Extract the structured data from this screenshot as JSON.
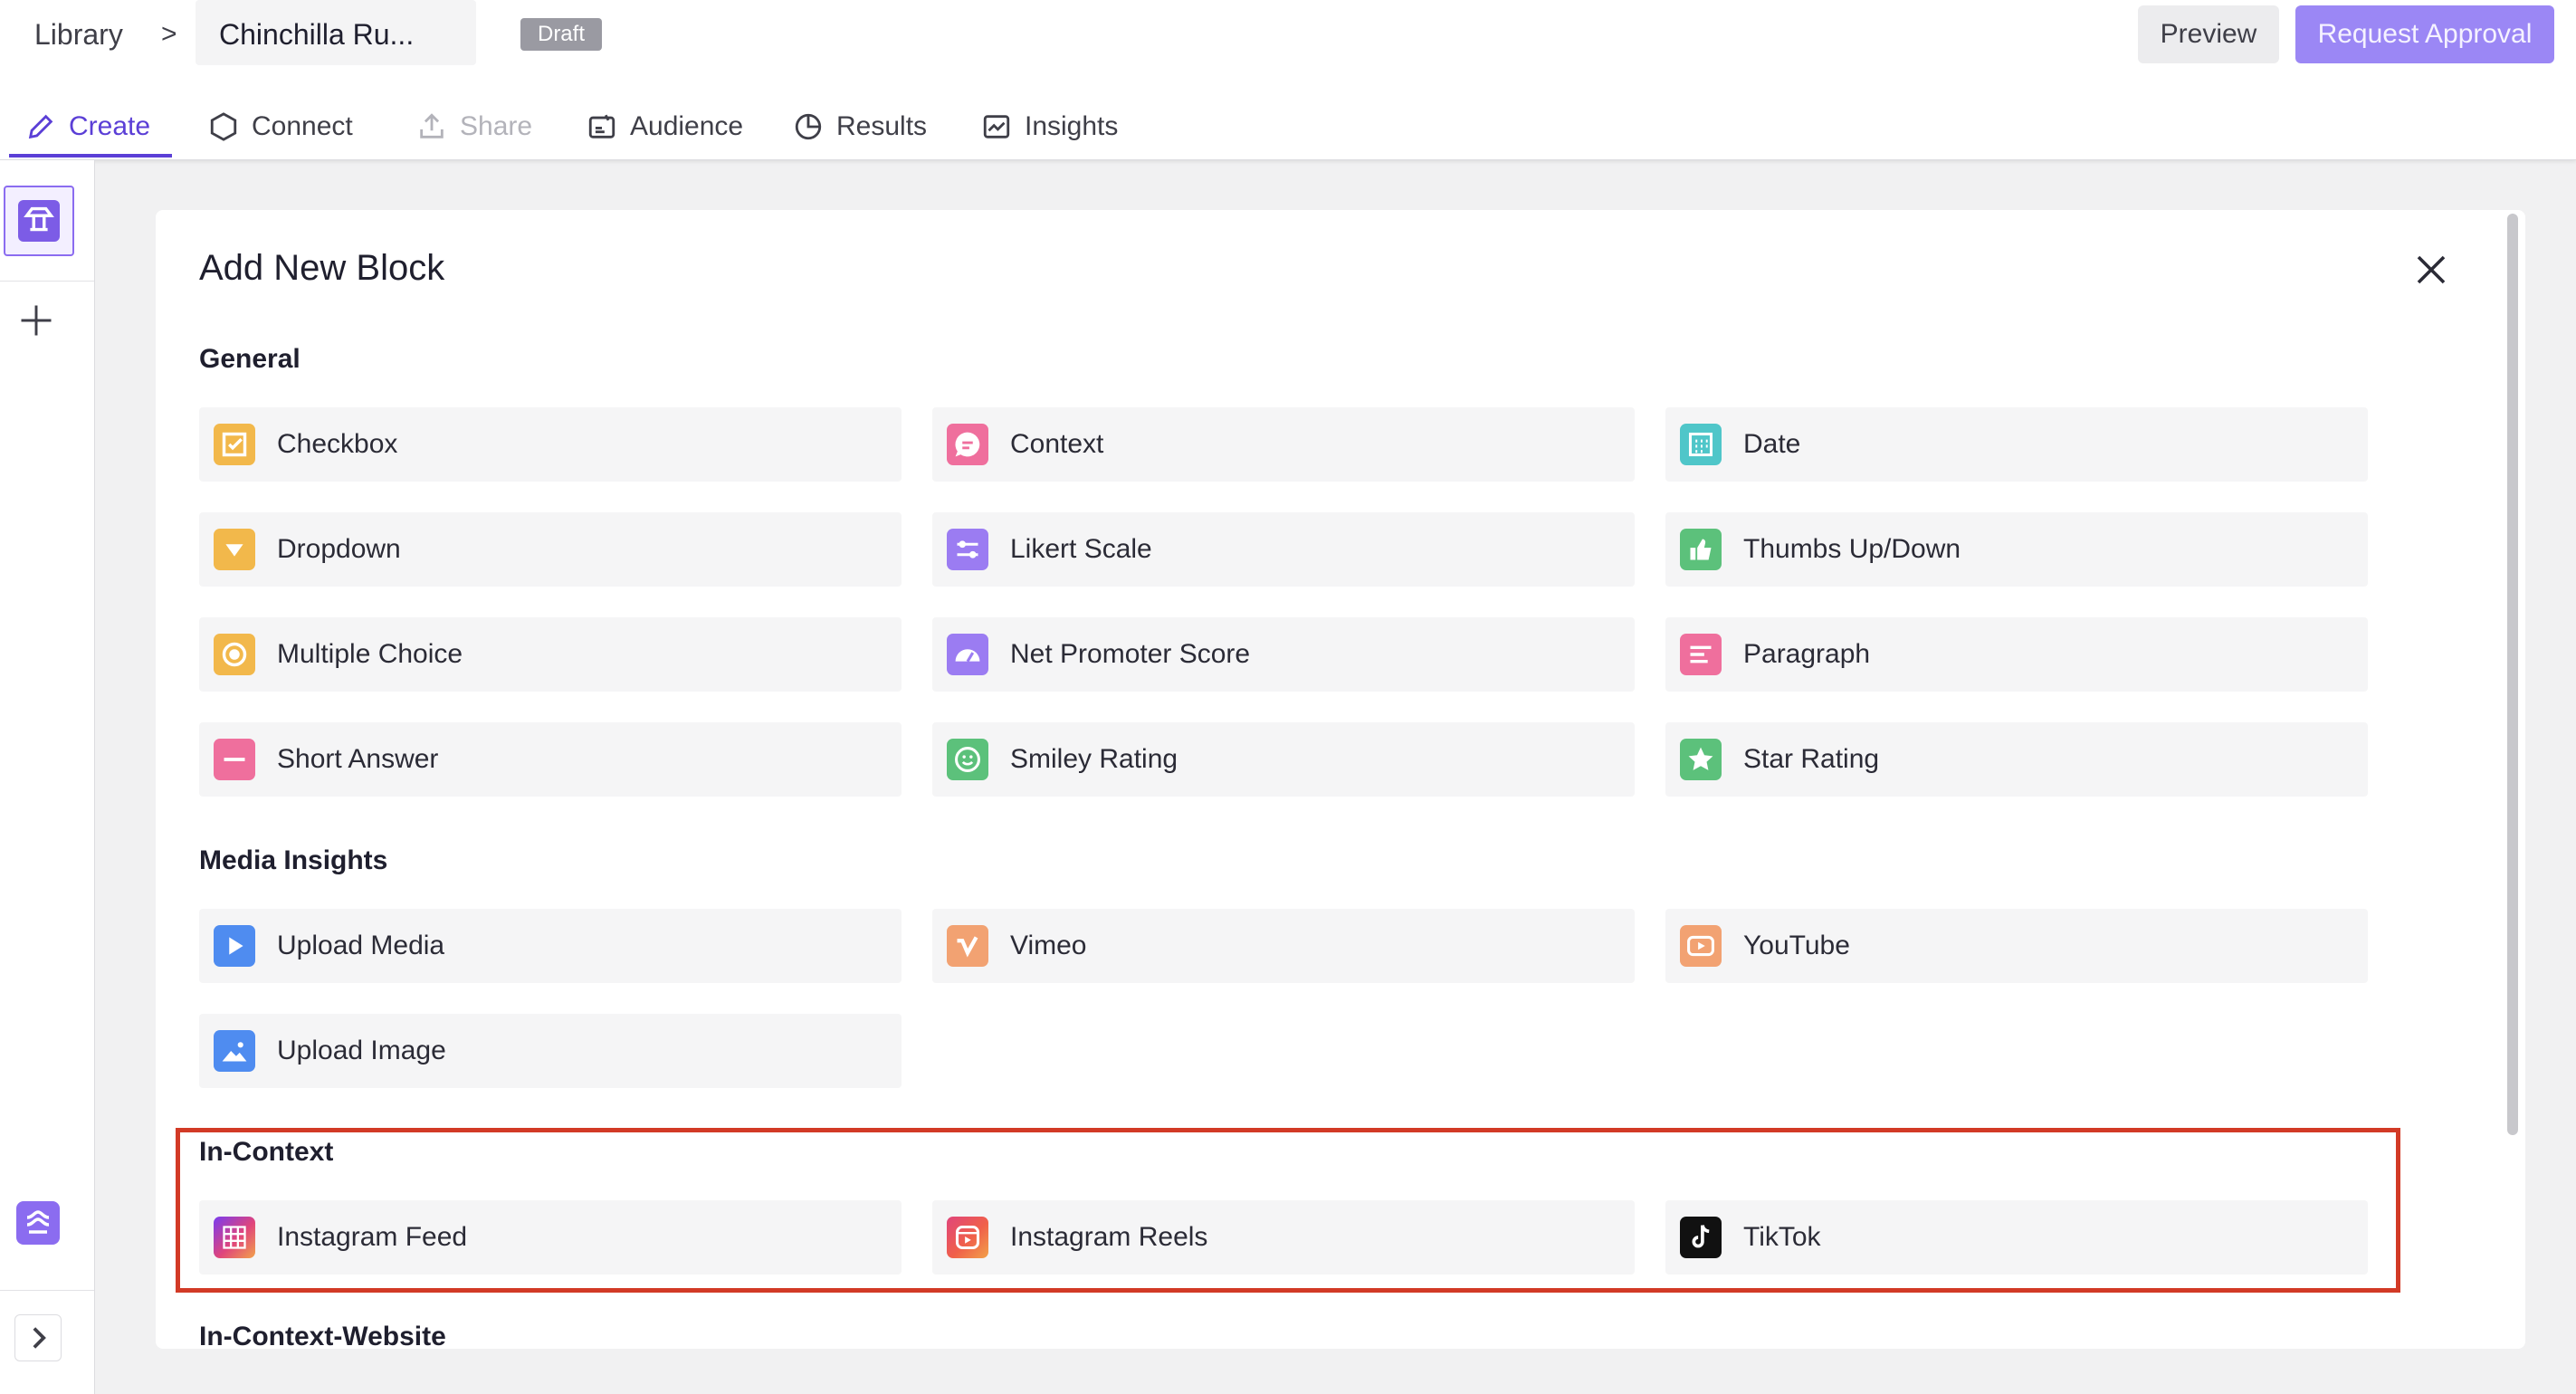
{
  "breadcrumb": {
    "library": "Library",
    "separator": ">",
    "title": "Chinchilla Ru..."
  },
  "status_badge": "Draft",
  "actions": {
    "preview": "Preview",
    "request_approval": "Request Approval"
  },
  "tabs": [
    {
      "label": "Create",
      "icon": "pencil-icon",
      "state": "active"
    },
    {
      "label": "Connect",
      "icon": "hexagon-icon",
      "state": "normal"
    },
    {
      "label": "Share",
      "icon": "share-icon",
      "state": "disabled"
    },
    {
      "label": "Audience",
      "icon": "audience-icon",
      "state": "normal"
    },
    {
      "label": "Results",
      "icon": "pie-chart-icon",
      "state": "normal"
    },
    {
      "label": "Insights",
      "icon": "trend-chart-icon",
      "state": "normal"
    }
  ],
  "modal": {
    "title": "Add New Block",
    "sections": [
      {
        "label": "General",
        "items": [
          {
            "label": "Checkbox",
            "icon": "checkbox-icon",
            "color": "#f2b84b"
          },
          {
            "label": "Context",
            "icon": "chat-bubble-icon",
            "color": "#ef6f9d"
          },
          {
            "label": "Date",
            "icon": "calendar-icon",
            "color": "#4fc6c9"
          },
          {
            "label": "Dropdown",
            "icon": "dropdown-triangle-icon",
            "color": "#f2b84b"
          },
          {
            "label": "Likert Scale",
            "icon": "sliders-icon",
            "color": "#9b7cf2"
          },
          {
            "label": "Thumbs Up/Down",
            "icon": "thumbs-up-icon",
            "color": "#5cc17b"
          },
          {
            "label": "Multiple Choice",
            "icon": "radio-icon",
            "color": "#f2b84b"
          },
          {
            "label": "Net Promoter Score",
            "icon": "gauge-icon",
            "color": "#9b7cf2"
          },
          {
            "label": "Paragraph",
            "icon": "paragraph-lines-icon",
            "color": "#ef6f9d"
          },
          {
            "label": "Short Answer",
            "icon": "short-answer-icon",
            "color": "#ef6f9d"
          },
          {
            "label": "Smiley Rating",
            "icon": "smiley-icon",
            "color": "#5cc17b"
          },
          {
            "label": "Star Rating",
            "icon": "star-icon",
            "color": "#5cc17b"
          }
        ]
      },
      {
        "label": "Media Insights",
        "items": [
          {
            "label": "Upload Media",
            "icon": "play-icon",
            "color": "#4f8cf0"
          },
          {
            "label": "Vimeo",
            "icon": "vimeo-icon",
            "color": "#f2a272"
          },
          {
            "label": "YouTube",
            "icon": "youtube-icon",
            "color": "#f2a272"
          },
          {
            "label": "Upload Image",
            "icon": "image-icon",
            "color": "#4f8cf0"
          }
        ]
      },
      {
        "label": "In-Context",
        "items": [
          {
            "label": "Instagram Feed",
            "icon": "instagram-grid-icon",
            "color": "#e0457b"
          },
          {
            "label": "Instagram Reels",
            "icon": "instagram-reels-icon",
            "color": "#f0604a"
          },
          {
            "label": "TikTok",
            "icon": "tiktok-icon",
            "color": "#111111"
          }
        ]
      },
      {
        "label": "In-Context-Website",
        "items": []
      }
    ]
  },
  "colors": {
    "accent": "#5b3fd6",
    "approval": "#9b87f5",
    "highlight": "#d23a26"
  }
}
